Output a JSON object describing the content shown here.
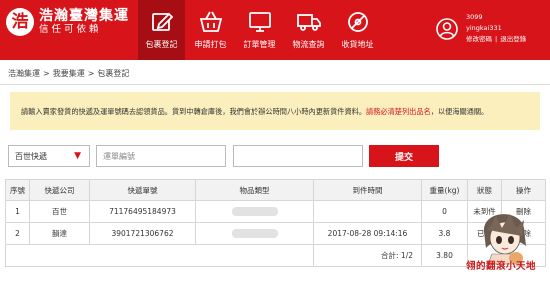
{
  "header": {
    "logo_char": "浩",
    "logo_title": "浩瀚臺灣集運",
    "logo_sub": "信任可依賴",
    "nav": [
      {
        "label": "包裹登記",
        "icon": "edit-icon",
        "active": true
      },
      {
        "label": "申請打包",
        "icon": "basket-icon",
        "active": false
      },
      {
        "label": "訂單管理",
        "icon": "monitor-icon",
        "active": false
      },
      {
        "label": "物流查詢",
        "icon": "truck-icon",
        "active": false
      },
      {
        "label": "收貨地址",
        "icon": "location-icon",
        "active": false
      }
    ],
    "user": {
      "id": "3099",
      "name": "yingkai331",
      "change_password": "修改密碼",
      "separator": "|",
      "logout": "退出登錄"
    }
  },
  "breadcrumb": [
    "浩瀚集運",
    ">",
    "我要集運",
    ">",
    "包裹登記"
  ],
  "notice": {
    "text_before": "請輸入賣家發貨的快遞及運單號碼去認領貨品。貨到中轉倉庫後，我們會於辦公時間八小時內更新貨件資料。",
    "highlight": "請務必清楚列出品名",
    "text_after": "，以便海關通關。",
    "highlight_color": "#d8141b"
  },
  "form": {
    "courier_selected": "百世快遞",
    "tracking_placeholder": "運單編號",
    "extra_value": "",
    "submit_label": "提交"
  },
  "table": {
    "headers": [
      "序號",
      "快遞公司",
      "快遞單號",
      "物品類型",
      "到件時間",
      "重量(kg)",
      "狀態",
      "操作"
    ],
    "rows": [
      {
        "no": "1",
        "courier": "百世",
        "tracking": "71176495184973",
        "arrival": "",
        "weight": "0",
        "status": "未到件",
        "action": "刪除"
      },
      {
        "no": "2",
        "courier": "韻達",
        "tracking": "3901721306762",
        "arrival": "2017-08-28 09:14:16",
        "weight": "3.8",
        "status": "已到",
        "action": "刪除"
      }
    ],
    "summary": {
      "count": "合計:  1/2",
      "weight": "3.80"
    }
  },
  "watermark": "翎的翻滾小天地",
  "colors": {
    "brand_red": "#d8141b",
    "nav_active": "#a70e13",
    "notice_bg": "#fbefbd"
  }
}
